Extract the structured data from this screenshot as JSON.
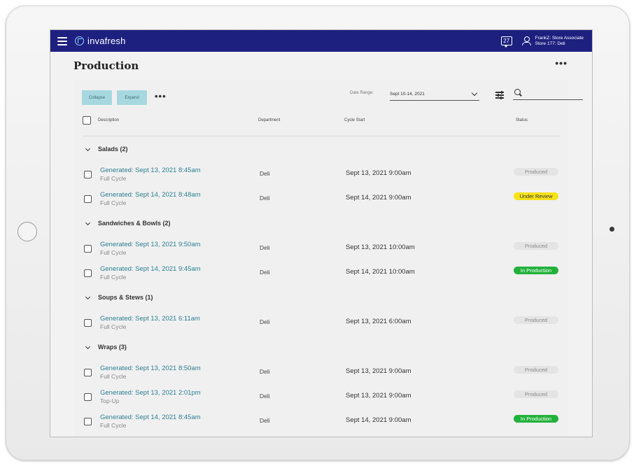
{
  "app": {
    "brand": "invafresh",
    "notifications": "27",
    "user_line1": "FrankZ: Store Associate",
    "user_line2": "Store 177: Deli"
  },
  "page": {
    "title": "Production",
    "more": "•••"
  },
  "toolbar": {
    "collapse_label": "Collapse",
    "expand_label": "Expand",
    "more": "•••",
    "date_range_label": "Date Range:",
    "date_range_value": "Sept 10-14, 2021",
    "search_placeholder": ""
  },
  "columns": {
    "description": "Description",
    "department": "Department",
    "cycle_start": "Cycle Start",
    "status": "Status"
  },
  "groups": [
    {
      "label": "Salads (2)",
      "rows": [
        {
          "title": "Generated: Sept 13, 2021  8:45am",
          "sub": "Full Cycle",
          "dept": "Deli",
          "cycle": "Sept 13, 2021 9:00am",
          "status": "Produced",
          "status_type": "produced"
        },
        {
          "title": "Generated: Sept 14, 2021  8:48am",
          "sub": "Full Cycle",
          "dept": "Deli",
          "cycle": "Sept 14, 2021 9:00am",
          "status": "Under Review",
          "status_type": "review"
        }
      ]
    },
    {
      "label": "Sandwiches & Bowls (2)",
      "rows": [
        {
          "title": "Generated: Sept 13, 2021  9:50am",
          "sub": "Full Cycle",
          "dept": "Deli",
          "cycle": "Sept 13, 2021 10:00am",
          "status": "Produced",
          "status_type": "produced"
        },
        {
          "title": "Generated: Sept 14, 2021  9:45am",
          "sub": "Full Cycle",
          "dept": "Deli",
          "cycle": "Sept 14, 2021 10:00am",
          "status": "In Production",
          "status_type": "production"
        }
      ]
    },
    {
      "label": "Soups & Stews (1)",
      "rows": [
        {
          "title": "Generated: Sept 13, 2021  6:11am",
          "sub": "Full Cycle",
          "dept": "Deli",
          "cycle": "Sept 13, 2021 6:00am",
          "status": "Produced",
          "status_type": "produced"
        }
      ]
    },
    {
      "label": "Wraps (3)",
      "rows": [
        {
          "title": "Generated: Sept 13, 2021  8:50am",
          "sub": "Full Cycle",
          "dept": "Deli",
          "cycle": "Sept 13, 2021 9:00am",
          "status": "Produced",
          "status_type": "produced"
        },
        {
          "title": "Generated: Sept 13, 2021  2:01pm",
          "sub": "Top-Up",
          "dept": "Deli",
          "cycle": "Sept 13, 2021 9:00am",
          "status": "Produced",
          "status_type": "produced"
        },
        {
          "title": "Generated: Sept 14, 2021  8:45am",
          "sub": "Full Cycle",
          "dept": "Deli",
          "cycle": "Sept 14, 2021 9:00am",
          "status": "In Production",
          "status_type": "production"
        }
      ]
    }
  ]
}
